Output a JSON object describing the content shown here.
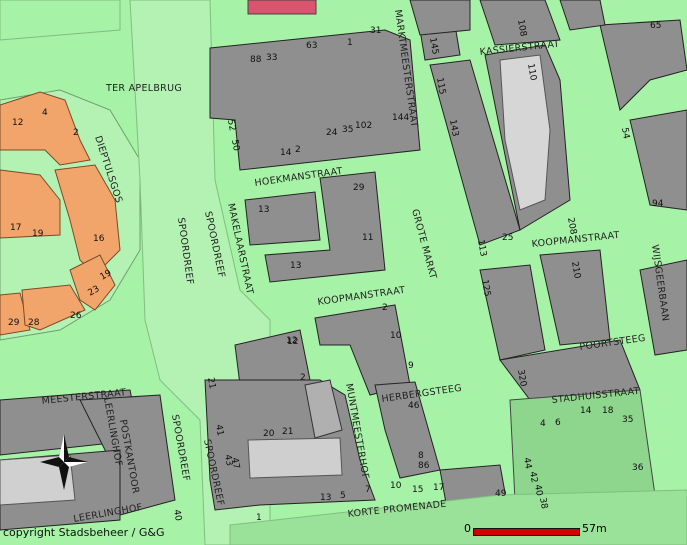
{
  "map": {
    "colors": {
      "ground": "#a6f2a6",
      "street": "#8fe08f",
      "building": "#8f8f8f",
      "residential": "#f2a56b",
      "public_space": "#b4f2b4",
      "highlight": "#d9546e"
    },
    "streets": [
      "TER APELBRUG",
      "MARKTMEESTERSTRAAT",
      "KASSIERSTRAAT",
      "HOEKMANSTRAAT",
      "SPOORDREEF",
      "SPOORDREEF",
      "MAKELAARSTRAAT",
      "GROTE MARKT",
      "KOOPMANSTRAAT",
      "KOOPMANSTRAAT",
      "WIJSGEERBAAN",
      "POORTSTEEG",
      "STADHUISSTRAAT",
      "HERBERGSTEEG",
      "MUNTMEESTERHOF",
      "MEESTERSTRAAT",
      "LEERLINGHOF",
      "POSTKANTOOR",
      "SPOORDREEF",
      "LEERLINGHOF",
      "KORTE PROMENADE",
      "SPOORDREEF",
      "DIEPTULSGOS"
    ],
    "house_numbers": [
      "88",
      "33",
      "63",
      "1",
      "31",
      "52",
      "50",
      "24",
      "35",
      "102",
      "144",
      "14",
      "2",
      "145",
      "115",
      "143",
      "108",
      "110",
      "65",
      "29",
      "13",
      "11",
      "13",
      "2",
      "10",
      "12",
      "125",
      "210",
      "320",
      "4",
      "6",
      "14",
      "18",
      "35",
      "36",
      "44",
      "42",
      "40",
      "38",
      "12",
      "4",
      "2",
      "20",
      "21",
      "17",
      "13",
      "5",
      "7",
      "8",
      "9",
      "10",
      "15",
      "17",
      "12",
      "2",
      "21",
      "19",
      "16",
      "23",
      "19",
      "29",
      "28",
      "26",
      "43",
      "47",
      "41",
      "40",
      "1",
      "49",
      "46",
      "86",
      "208",
      "94",
      "113",
      "54",
      "25"
    ],
    "copyright": "copyright Stadsbeheer / G&G",
    "scalebar": {
      "start": "0",
      "end": "57m"
    },
    "north_arrow_icon": "compass-rose-icon"
  }
}
